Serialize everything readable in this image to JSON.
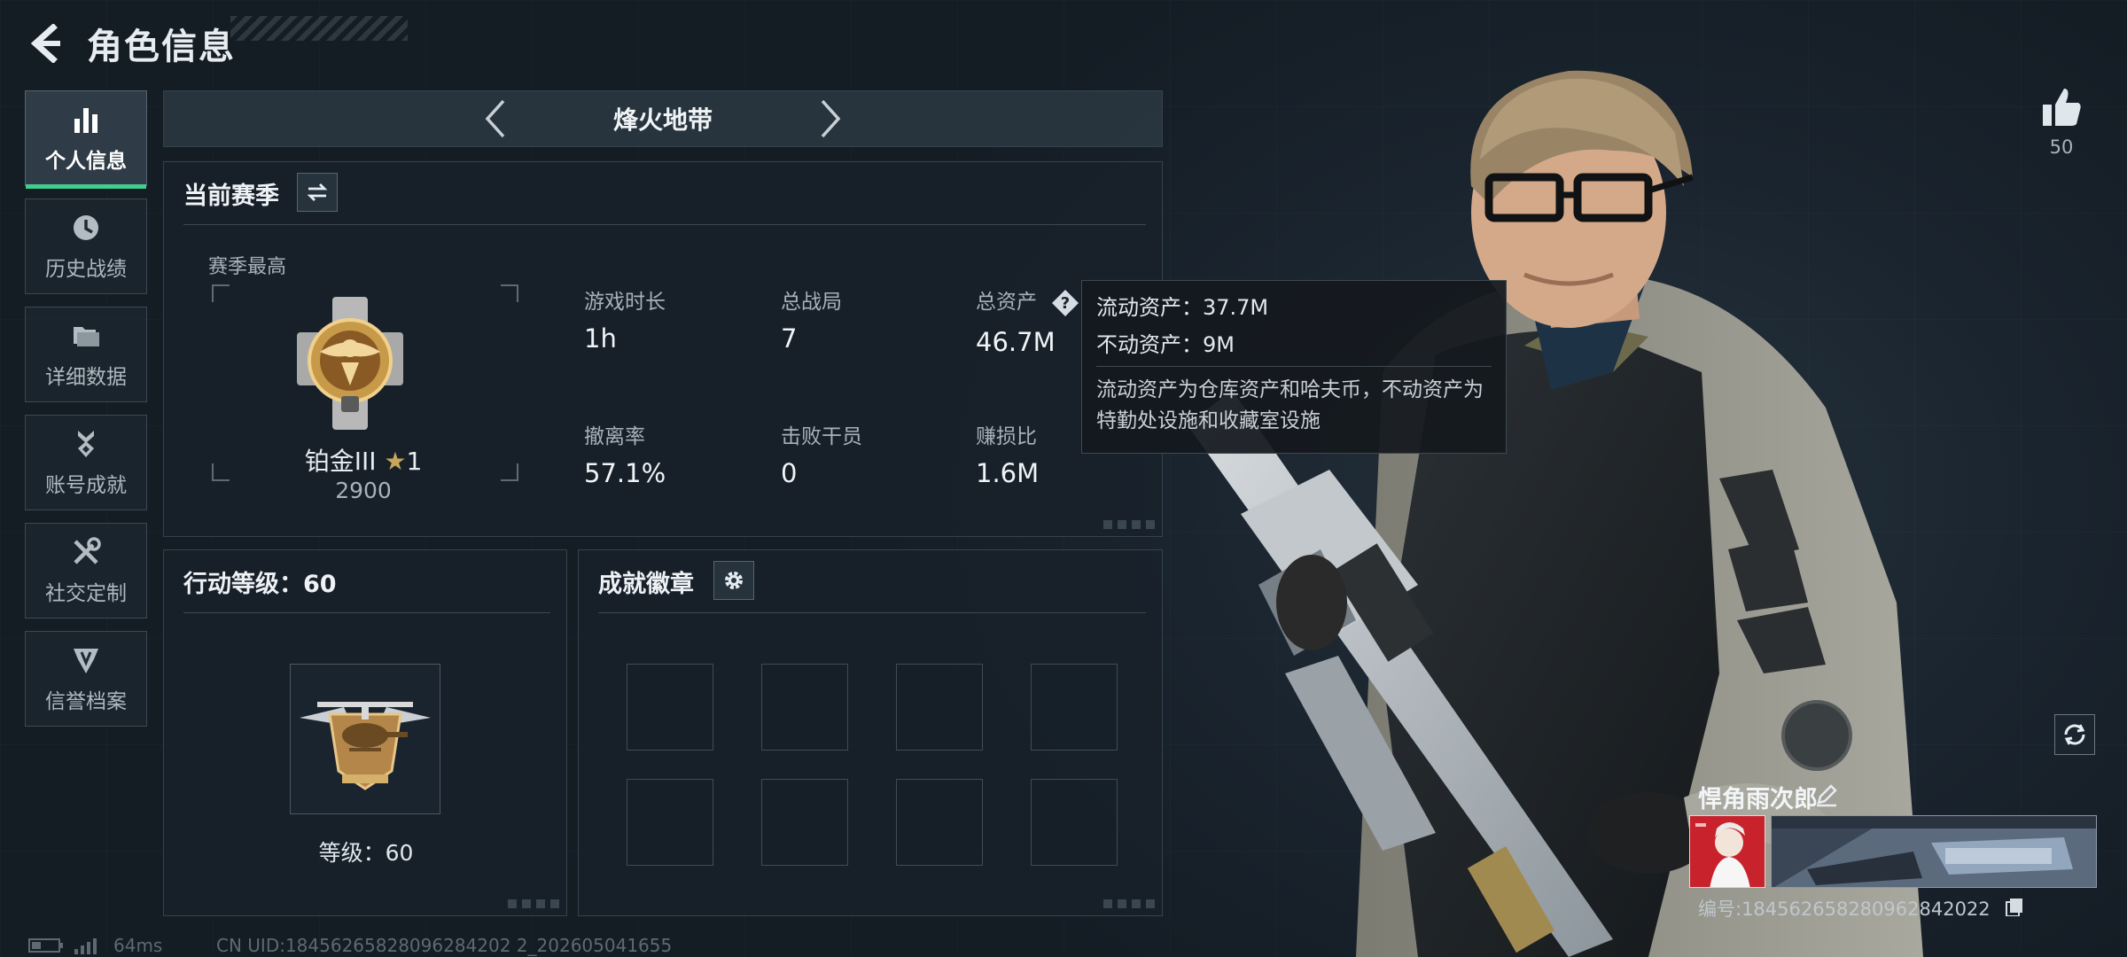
{
  "header": {
    "title": "角色信息"
  },
  "sidebar": {
    "items": [
      {
        "label": "个人信息",
        "icon": "bar-chart-icon",
        "active": true
      },
      {
        "label": "历史战绩",
        "icon": "clock-icon",
        "active": false
      },
      {
        "label": "详细数据",
        "icon": "folder-icon",
        "active": false
      },
      {
        "label": "账号成就",
        "icon": "medal-icon",
        "active": false
      },
      {
        "label": "社交定制",
        "icon": "tools-icon",
        "active": false
      },
      {
        "label": "信誉档案",
        "icon": "shield-icon",
        "active": false
      }
    ]
  },
  "mode": {
    "title": "烽火地带"
  },
  "season": {
    "title": "当前赛季",
    "best_label": "赛季最高",
    "rank_name": "铂金III",
    "rank_stars": "1",
    "rank_score": "2900",
    "stats": [
      {
        "label": "游戏时长",
        "value": "1h"
      },
      {
        "label": "总战局",
        "value": "7"
      },
      {
        "label": "总资产",
        "value": "46.7M"
      },
      {
        "label": "撤离率",
        "value": "57.1%"
      },
      {
        "label": "击败干员",
        "value": "0"
      },
      {
        "label": "赚损比",
        "value": "1.6M"
      }
    ]
  },
  "tooltip": {
    "liquid": "流动资产：37.7M",
    "fixed": "不动资产：9M",
    "description": "流动资产为仓库资产和哈夫币，不动资产为特勤处设施和收藏室设施"
  },
  "level": {
    "title": "行动等级：60",
    "text": "等级：60"
  },
  "achievements": {
    "title": "成就徽章"
  },
  "social": {
    "like_count": "50"
  },
  "player": {
    "name": "悍角雨次郎",
    "id": "编号:18456265828096284202​2"
  },
  "status": {
    "ping": "64ms",
    "uid": "CN UID:18456265828096284202 2_202605041655"
  },
  "colors": {
    "accent": "#3fd08f",
    "gold": "#c7a55a"
  }
}
